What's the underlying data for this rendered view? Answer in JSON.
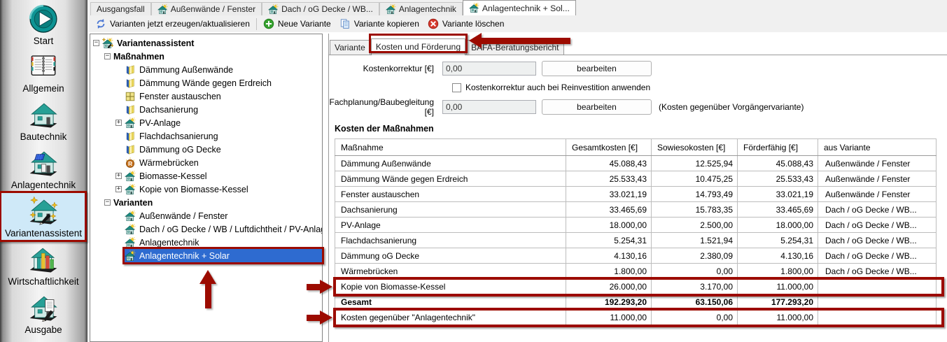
{
  "annotation_color": "#9c0b00",
  "sidebar": {
    "items": [
      {
        "label": "Start",
        "icon": "start-icon",
        "selected": false
      },
      {
        "label": "Allgemein",
        "icon": "notebook-icon",
        "selected": false
      },
      {
        "label": "Bautechnik",
        "icon": "house-icon",
        "selected": false
      },
      {
        "label": "Anlagentechnik",
        "icon": "house-solar-icon",
        "selected": false
      },
      {
        "label": "Variantenassistent",
        "icon": "house-wand-icon",
        "selected": true
      },
      {
        "label": "Wirtschaftlichkeit",
        "icon": "house-chart-icon",
        "selected": false
      },
      {
        "label": "Ausgabe",
        "icon": "house-report-icon",
        "selected": false
      }
    ]
  },
  "document_tabs": [
    {
      "label": "Ausgangsfall",
      "icon": false,
      "active": false
    },
    {
      "label": "Außenwände / Fenster",
      "icon": true,
      "active": false
    },
    {
      "label": "Dach / oG Decke / WB...",
      "icon": true,
      "active": false
    },
    {
      "label": "Anlagentechnik",
      "icon": true,
      "active": false
    },
    {
      "label": "Anlagentechnik + Sol...",
      "icon": true,
      "active": true
    }
  ],
  "toolbar": [
    {
      "label": "Varianten jetzt erzeugen/aktualisieren",
      "icon": "refresh-icon",
      "separator_after": true
    },
    {
      "label": "Neue Variante",
      "icon": "add-icon",
      "separator_after": false
    },
    {
      "label": "Variante kopieren",
      "icon": "copy-icon",
      "separator_after": false
    },
    {
      "label": "Variante löschen",
      "icon": "delete-icon",
      "separator_after": false
    }
  ],
  "tree": [
    {
      "level": 0,
      "expander": "minus",
      "icon": "house-wand-sm-icon",
      "label": "Variantenassistent",
      "bold": true,
      "selected": false
    },
    {
      "level": 1,
      "expander": "minus",
      "icon": null,
      "label": "Maßnahmen",
      "bold": true,
      "selected": false
    },
    {
      "level": 2,
      "expander": null,
      "icon": "insulation-icon",
      "label": "Dämmung Außenwände",
      "bold": false,
      "selected": false
    },
    {
      "level": 2,
      "expander": null,
      "icon": "insulation-icon",
      "label": "Dämmung Wände gegen Erdreich",
      "bold": false,
      "selected": false
    },
    {
      "level": 2,
      "expander": null,
      "icon": "window-icon",
      "label": "Fenster austauschen",
      "bold": false,
      "selected": false
    },
    {
      "level": 2,
      "expander": null,
      "icon": "insulation-icon",
      "label": "Dachsanierung",
      "bold": false,
      "selected": false
    },
    {
      "level": 2,
      "expander": "plus",
      "icon": "house-sun-icon",
      "label": "PV-Anlage",
      "bold": false,
      "selected": false
    },
    {
      "level": 2,
      "expander": null,
      "icon": "insulation-icon",
      "label": "Flachdachsanierung",
      "bold": false,
      "selected": false
    },
    {
      "level": 2,
      "expander": null,
      "icon": "insulation-icon",
      "label": "Dämmung oG Decke",
      "bold": false,
      "selected": false
    },
    {
      "level": 2,
      "expander": null,
      "icon": "thermal-bridge-icon",
      "label": "Wärmebrücken",
      "bold": false,
      "selected": false
    },
    {
      "level": 2,
      "expander": "plus",
      "icon": "house-sun-icon",
      "label": "Biomasse-Kessel",
      "bold": false,
      "selected": false
    },
    {
      "level": 2,
      "expander": "plus",
      "icon": "house-sun-icon",
      "label": "Kopie von Biomasse-Kessel",
      "bold": false,
      "selected": false
    },
    {
      "level": 1,
      "expander": "minus",
      "icon": null,
      "label": "Varianten",
      "bold": true,
      "selected": false
    },
    {
      "level": 2,
      "expander": null,
      "icon": "house-sun-icon",
      "label": "Außenwände / Fenster",
      "bold": false,
      "selected": false
    },
    {
      "level": 2,
      "expander": null,
      "icon": "house-sun-icon",
      "label": "Dach / oG Decke / WB / Luftdichtheit / PV-Anlage",
      "bold": false,
      "selected": false
    },
    {
      "level": 2,
      "expander": null,
      "icon": "house-sun-icon",
      "label": "Anlagentechnik",
      "bold": false,
      "selected": false
    },
    {
      "level": 2,
      "expander": null,
      "icon": "house-sun-icon",
      "label": "Anlagentechnik + Solar",
      "bold": false,
      "selected": true
    }
  ],
  "main": {
    "tabs": [
      {
        "label": "Variante",
        "active": false
      },
      {
        "label": "Kosten und Förderung",
        "active": true
      },
      {
        "label": "BAFA-Beratungsbericht",
        "active": false
      }
    ],
    "form": {
      "kostenkorrektur_label": "Kostenkorrektur [€]",
      "kostenkorrektur_value": "0,00",
      "kostenkorrektur_button": "bearbeiten",
      "checkbox_label": "Kostenkorrektur auch bei Reinvestition anwenden",
      "checkbox_checked": false,
      "fachplanung_label": "Fachplanung/Baubegleitung [€]",
      "fachplanung_value": "0,00",
      "fachplanung_button": "bearbeiten",
      "fachplanung_note": "(Kosten gegenüber Vorgängervariante)"
    },
    "table": {
      "title": "Kosten der Maßnahmen",
      "columns": [
        "Maßnahme",
        "Gesamtkosten [€]",
        "Sowiesokosten [€]",
        "Förderfähig [€]",
        "aus Variante"
      ],
      "rows": [
        {
          "cells": [
            "Dämmung Außenwände",
            "45.088,43",
            "12.525,94",
            "45.088,43",
            "Außenwände / Fenster"
          ],
          "bold": false,
          "annotated": false
        },
        {
          "cells": [
            "Dämmung Wände gegen Erdreich",
            "25.533,43",
            "10.475,25",
            "25.533,43",
            "Außenwände / Fenster"
          ],
          "bold": false,
          "annotated": false
        },
        {
          "cells": [
            "Fenster austauschen",
            "33.021,19",
            "14.793,49",
            "33.021,19",
            "Außenwände / Fenster"
          ],
          "bold": false,
          "annotated": false
        },
        {
          "cells": [
            "Dachsanierung",
            "33.465,69",
            "15.783,35",
            "33.465,69",
            "Dach / oG Decke / WB..."
          ],
          "bold": false,
          "annotated": false
        },
        {
          "cells": [
            "PV-Anlage",
            "18.000,00",
            "2.500,00",
            "18.000,00",
            "Dach / oG Decke / WB..."
          ],
          "bold": false,
          "annotated": false
        },
        {
          "cells": [
            "Flachdachsanierung",
            "5.254,31",
            "1.521,94",
            "5.254,31",
            "Dach / oG Decke / WB..."
          ],
          "bold": false,
          "annotated": false
        },
        {
          "cells": [
            "Dämmung oG Decke",
            "4.130,16",
            "2.380,09",
            "4.130,16",
            "Dach / oG Decke / WB..."
          ],
          "bold": false,
          "annotated": false
        },
        {
          "cells": [
            "Wärmebrücken",
            "1.800,00",
            "0,00",
            "1.800,00",
            "Dach / oG Decke / WB..."
          ],
          "bold": false,
          "annotated": false
        },
        {
          "cells": [
            "Kopie von Biomasse-Kessel",
            "26.000,00",
            "3.170,00",
            "11.000,00",
            ""
          ],
          "bold": false,
          "annotated": true
        },
        {
          "cells": [
            "Gesamt",
            "192.293,20",
            "63.150,06",
            "177.293,20",
            ""
          ],
          "bold": true,
          "annotated": false
        },
        {
          "cells": [
            "Kosten gegenüber \"Anlagentechnik\"",
            "11.000,00",
            "0,00",
            "11.000,00",
            ""
          ],
          "bold": false,
          "annotated": true
        }
      ]
    }
  }
}
